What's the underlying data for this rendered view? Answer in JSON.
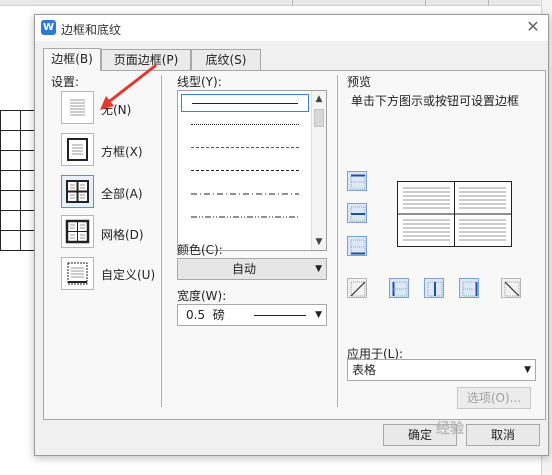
{
  "dialog": {
    "title": "边框和底纹",
    "app_icon_letter": "W",
    "close_icon": "close-icon"
  },
  "tabs": [
    {
      "label": "边框(B)",
      "active": true
    },
    {
      "label": "页面边框(P)",
      "active": false
    },
    {
      "label": "底纹(S)",
      "active": false
    }
  ],
  "settings": {
    "label": "设置:",
    "options": [
      {
        "label": "无(N)",
        "icon": "none-border-icon",
        "selected": false
      },
      {
        "label": "方框(X)",
        "icon": "box-border-icon",
        "selected": false
      },
      {
        "label": "全部(A)",
        "icon": "all-borders-icon",
        "selected": true
      },
      {
        "label": "网格(D)",
        "icon": "grid-border-icon",
        "selected": false
      },
      {
        "label": "自定义(U)",
        "icon": "custom-border-icon",
        "selected": false
      }
    ]
  },
  "line_style": {
    "label": "线型(Y):",
    "items": [
      "solid",
      "dotted",
      "dashed-fine",
      "dashed",
      "dash-dot",
      "dash-dot-dot"
    ],
    "selected_index": 0
  },
  "color": {
    "label": "颜色(C):",
    "value": "自动"
  },
  "width": {
    "label": "宽度(W):",
    "value": "0.5  磅"
  },
  "preview": {
    "label": "预览",
    "hint": "单击下方图示或按钮可设置边框"
  },
  "apply_to": {
    "label": "应用于(L):",
    "value": "表格"
  },
  "buttons": {
    "options": "选项(O)...",
    "ok": "确定",
    "cancel": "取消"
  },
  "watermark": "经验",
  "colors": {
    "accent": "#2b7ad9",
    "annotation_arrow": "#e03a2f",
    "selected_border": "#5b8fd0"
  }
}
